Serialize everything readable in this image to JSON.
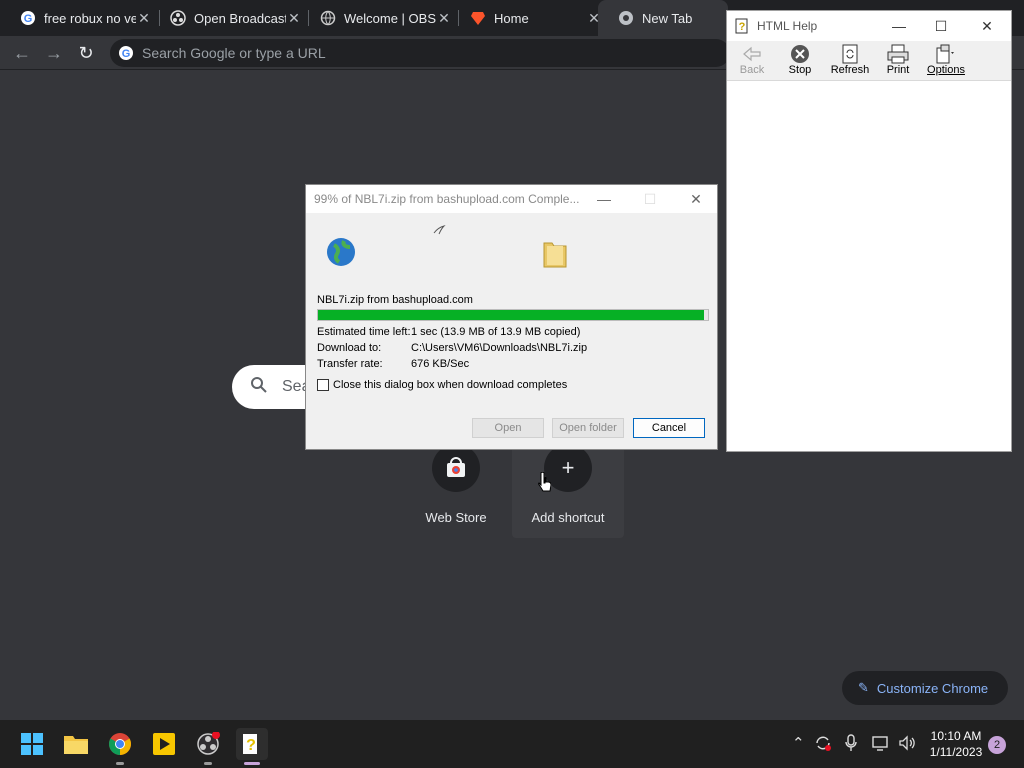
{
  "browser": {
    "tabs": [
      {
        "label": "free robux no ve",
        "icon": "google-icon"
      },
      {
        "label": "Open Broadcast",
        "icon": "obs-icon"
      },
      {
        "label": "Welcome | OBS",
        "icon": "globe-icon"
      },
      {
        "label": "Home",
        "icon": "brave-icon"
      },
      {
        "label": "New Tab",
        "icon": "chrome-icon"
      }
    ],
    "omnibox_placeholder": "Search Google or type a URL"
  },
  "ntp": {
    "search_placeholder": "Sea",
    "shortcuts": [
      {
        "label": "Web Store",
        "icon": "web-store-icon"
      },
      {
        "label": "Add shortcut",
        "icon": "plus-icon"
      }
    ],
    "customize_label": "Customize Chrome"
  },
  "help_window": {
    "title": "HTML Help",
    "toolbar": [
      {
        "label": "Back",
        "icon": "back-arrow-icon",
        "enabled": false
      },
      {
        "label": "Stop",
        "icon": "stop-icon",
        "enabled": true
      },
      {
        "label": "Refresh",
        "icon": "refresh-icon",
        "enabled": true
      },
      {
        "label": "Print",
        "icon": "print-icon",
        "enabled": true
      },
      {
        "label": "Options",
        "icon": "options-icon",
        "enabled": true
      }
    ]
  },
  "download_dialog": {
    "title": "99% of NBL7i.zip from bashupload.com Comple...",
    "source": "NBL7i.zip from bashupload.com",
    "progress": 0.99,
    "rows": [
      {
        "key": "Estimated time left:",
        "value": "1 sec (13.9 MB of 13.9 MB copied)"
      },
      {
        "key": "Download to:",
        "value": "C:\\Users\\VM6\\Downloads\\NBL7i.zip"
      },
      {
        "key": "Transfer rate:",
        "value": "676 KB/Sec"
      }
    ],
    "close_when_done_label": "Close this dialog box when download completes",
    "close_when_done_checked": false,
    "buttons": {
      "open": "Open",
      "open_folder": "Open folder",
      "cancel": "Cancel"
    }
  },
  "taskbar": {
    "apps": [
      "windows-start-icon",
      "file-explorer-icon",
      "chrome-icon",
      "media-player-icon",
      "obs-icon",
      "html-help-icon"
    ],
    "clock_time": "10:10 AM",
    "clock_date": "1/11/2023",
    "notification_count": "2"
  },
  "colors": {
    "chrome_bg": "#35363a",
    "tabstrip_bg": "#202124",
    "progress_fill": "#06b025",
    "accent_link": "#8ab4f8",
    "dialog_bg": "#f0f0f0"
  }
}
